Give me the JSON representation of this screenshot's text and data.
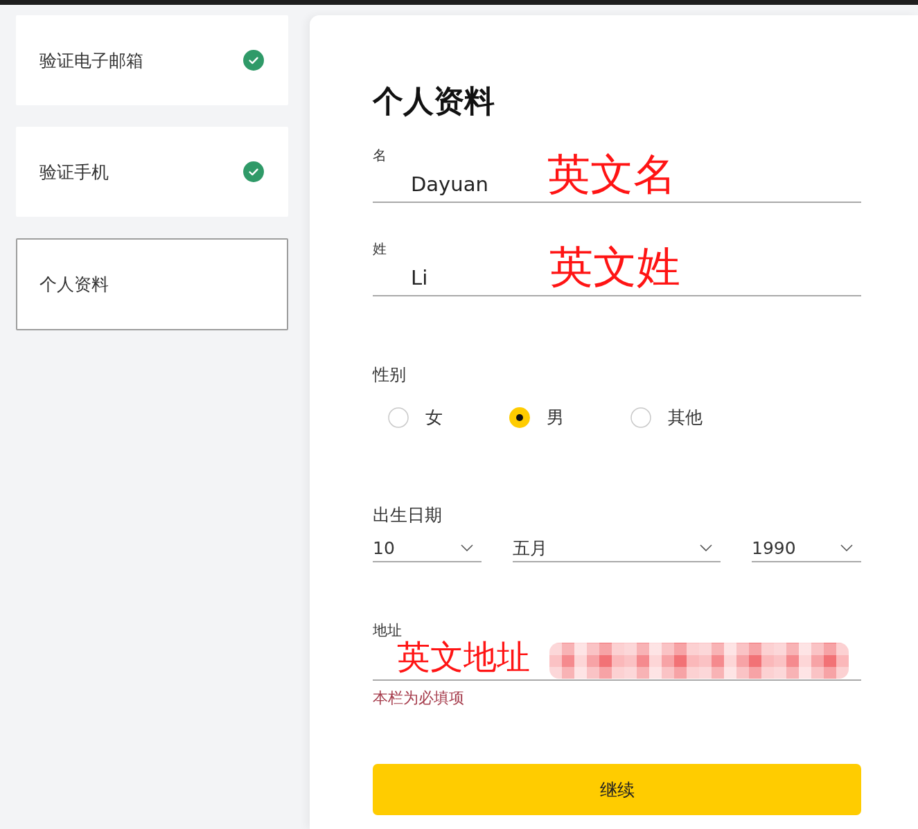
{
  "steps": [
    {
      "label": "验证电子邮箱",
      "completed": true,
      "selected": false
    },
    {
      "label": "验证手机",
      "completed": true,
      "selected": false
    },
    {
      "label": "个人资料",
      "completed": false,
      "selected": true
    }
  ],
  "form": {
    "title": "个人资料",
    "first_name": {
      "label": "名",
      "value": "Dayuan",
      "annotation": "英文名"
    },
    "last_name": {
      "label": "姓",
      "value": "Li",
      "annotation": "英文姓"
    },
    "gender": {
      "label": "性别",
      "options": [
        {
          "label": "女",
          "selected": false
        },
        {
          "label": "男",
          "selected": true
        },
        {
          "label": "其他",
          "selected": false
        }
      ]
    },
    "birth_date": {
      "label": "出生日期",
      "selects": [
        {
          "kind": "day",
          "value": "10"
        },
        {
          "kind": "month",
          "value": "五月"
        },
        {
          "kind": "year",
          "value": "1990"
        }
      ]
    },
    "address": {
      "label": "地址",
      "annotation": "英文地址",
      "redacted": true,
      "error": "本栏为必填项"
    },
    "continue_button": "继续"
  }
}
